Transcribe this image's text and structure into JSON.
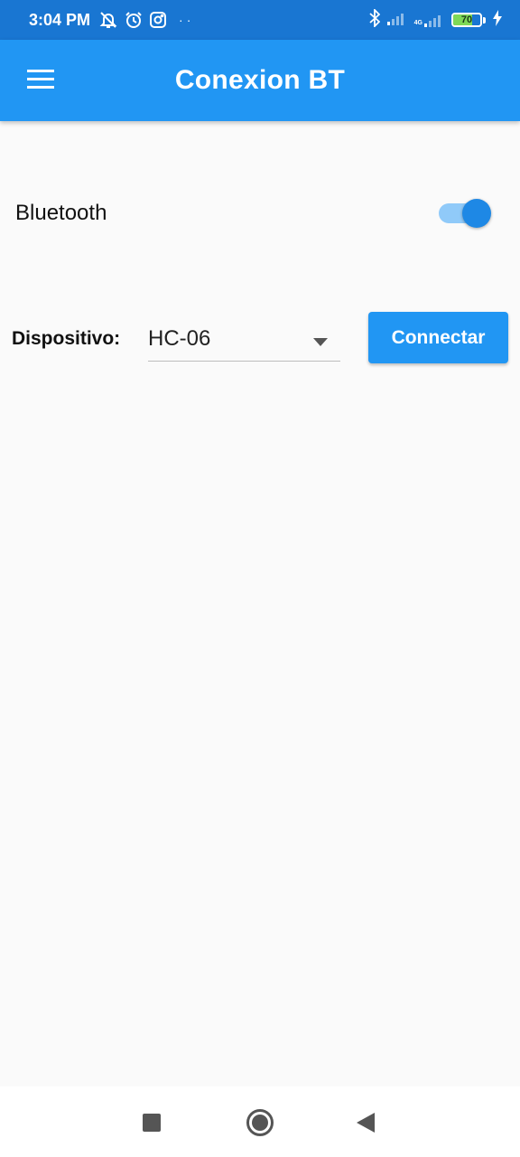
{
  "status_bar": {
    "time": "3:04 PM",
    "left_icons": [
      "notifications-off-icon",
      "alarm-icon",
      "instagram-icon"
    ],
    "overflow_dots": "··",
    "right_icons": [
      "bluetooth-icon",
      "signal-icon",
      "signal-4g-icon",
      "battery-icon",
      "charging-icon"
    ],
    "network_label": "4G",
    "battery_level": "70",
    "battery_fraction": 0.7,
    "background_color": "#1976d2"
  },
  "app_bar": {
    "title": "Conexion BT",
    "menu_icon": "menu-icon",
    "background_color": "#2196f3"
  },
  "bluetooth": {
    "label": "Bluetooth",
    "enabled": true,
    "accent_color": "#1e88e5"
  },
  "device": {
    "label": "Dispositivo:",
    "selected": "HC-06",
    "dropdown_icon": "dropdown-arrow-icon"
  },
  "connect_button": {
    "label": "Connectar",
    "background_color": "#2196f3"
  },
  "nav_bar": {
    "buttons": [
      "recents-icon",
      "home-icon",
      "back-icon"
    ]
  }
}
